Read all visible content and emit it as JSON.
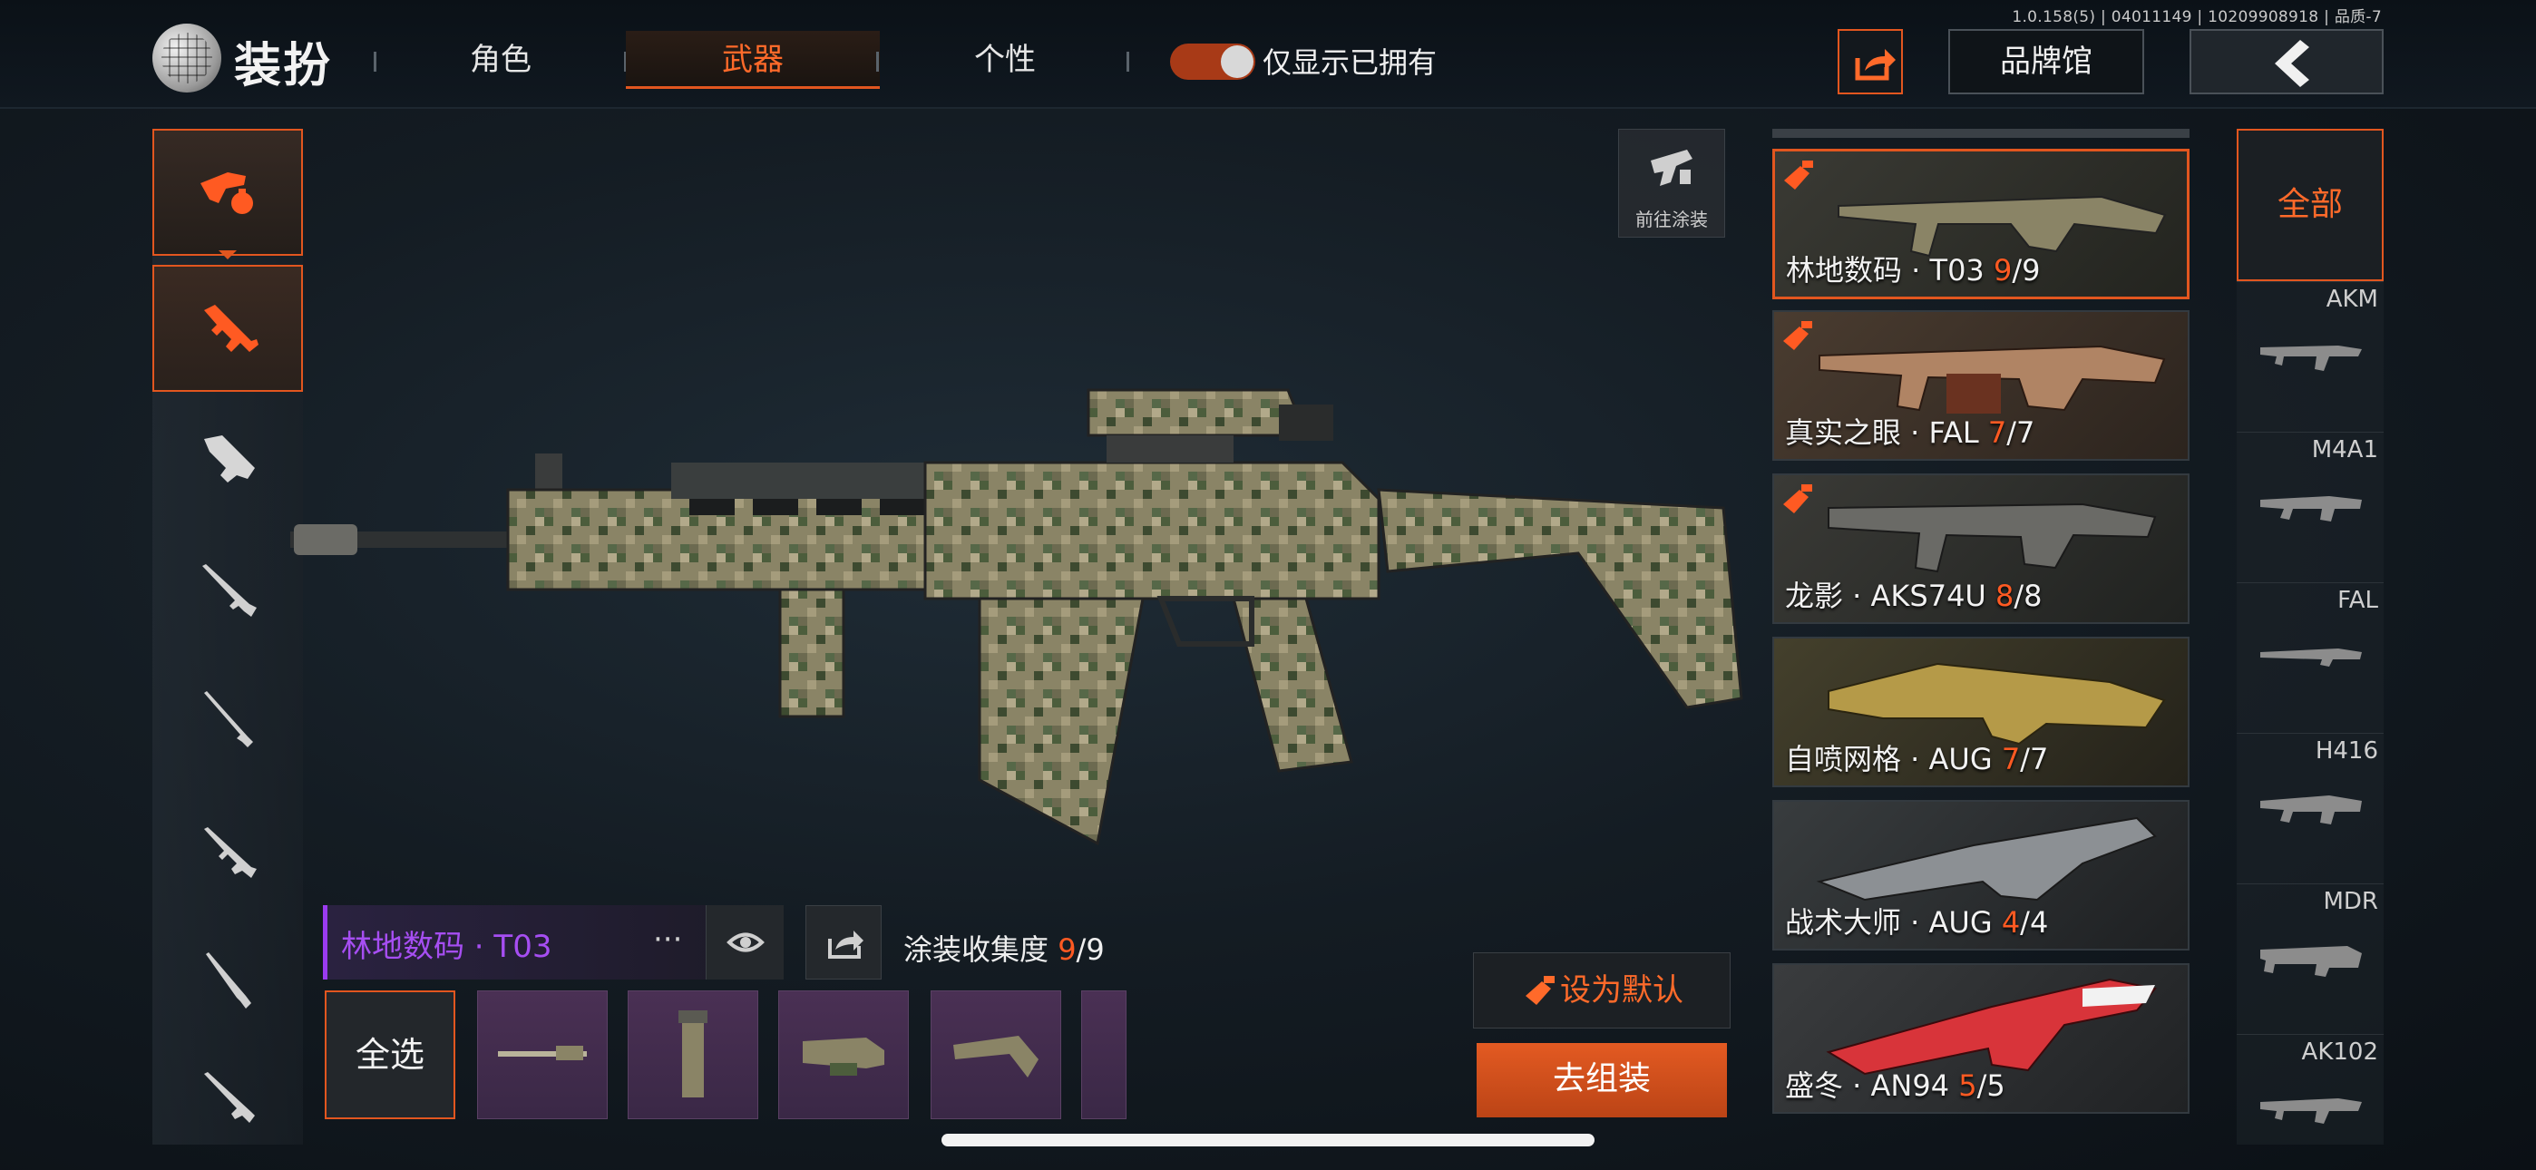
{
  "header": {
    "version": "1.0.158(5) | 04011149 | 10209908918 | 品质-7",
    "title": "装扮",
    "tabs": [
      {
        "label": "角色",
        "active": false
      },
      {
        "label": "武器",
        "active": true
      },
      {
        "label": "个性",
        "active": false
      }
    ],
    "owned_toggle": {
      "label": "仅显示已拥有",
      "on": true
    },
    "brand_button": "品牌馆"
  },
  "left_rail": {
    "icons": [
      "weapon-category-icon",
      "assault-rifle-icon",
      "smg-icon",
      "rifle-icon",
      "sniper-icon",
      "rifle-icon",
      "sniper-icon",
      "rifle-icon"
    ]
  },
  "main": {
    "goto_skin_label": "前往涂装",
    "skin_name": "林地数码 · T03",
    "more": "···",
    "collection": {
      "label": "涂装收集度",
      "current": "9",
      "sep": "/",
      "total": "9"
    },
    "select_all": "全选",
    "set_default": "设为默认",
    "assemble": "去组装"
  },
  "cards": [
    {
      "name": "林地数码 · T03 ",
      "cur": "9",
      "total": "/9",
      "selected": true
    },
    {
      "name": "真实之眼 · FAL ",
      "cur": "7",
      "total": "/7",
      "selected": false
    },
    {
      "name": "龙影 · AKS74U ",
      "cur": "8",
      "total": "/8",
      "selected": false
    },
    {
      "name": "自喷网格 · AUG ",
      "cur": "7",
      "total": "/7",
      "selected": false
    },
    {
      "name": "战术大师 · AUG ",
      "cur": "4",
      "total": "/4",
      "selected": false
    },
    {
      "name": "盛冬 · AN94 ",
      "cur": "5",
      "total": "/5",
      "selected": false
    }
  ],
  "right_rail": {
    "all_label": "全部",
    "models": [
      "AKM",
      "M4A1",
      "FAL",
      "H416",
      "MDR",
      "AK102"
    ]
  },
  "colors": {
    "accent": "#e2561f",
    "purple": "#a64ef2"
  }
}
